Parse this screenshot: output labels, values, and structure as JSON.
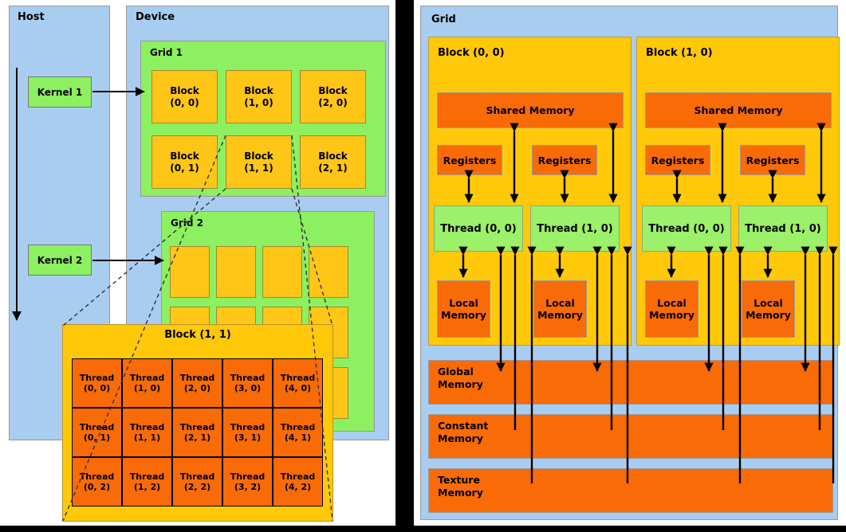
{
  "left_panel": {
    "host": {
      "title": "Host",
      "kernels": [
        {
          "label": "Kernel 1"
        },
        {
          "label": "Kernel 2"
        }
      ]
    },
    "device": {
      "title": "Device"
    },
    "grid1": {
      "title": "Grid 1",
      "blocks": [
        {
          "label": "Block\n(0, 0)"
        },
        {
          "label": "Block\n(1, 0)"
        },
        {
          "label": "Block\n(2, 0)"
        },
        {
          "label": "Block\n(0, 1)"
        },
        {
          "label": "Block\n(1, 1)"
        },
        {
          "label": "Block\n(2, 1)"
        }
      ]
    },
    "grid2": {
      "title": "Grid 2",
      "cols": 4,
      "rows": 3
    },
    "block_detail": {
      "title": "Block (1, 1)",
      "threads": [
        [
          "Thread\n(0, 0)",
          "Thread\n(1, 0)",
          "Thread\n(2, 0)",
          "Thread\n(3, 0)",
          "Thread\n(4, 0)"
        ],
        [
          "Thread\n(0, 1)",
          "Thread\n(1, 1)",
          "Thread\n(2, 1)",
          "Thread\n(3, 1)",
          "Thread\n(4, 1)"
        ],
        [
          "Thread\n(0, 2)",
          "Thread\n(1, 2)",
          "Thread\n(2, 2)",
          "Thread\n(3, 2)",
          "Thread\n(4, 2)"
        ]
      ]
    }
  },
  "right_panel": {
    "grid": {
      "title": "Grid"
    },
    "blocks": [
      {
        "title": "Block (0, 0)",
        "shared_memory": "Shared Memory",
        "lanes": [
          {
            "registers": "Registers",
            "thread": "Thread (0, 0)",
            "local_memory": "Local\nMemory"
          },
          {
            "registers": "Registers",
            "thread": "Thread (1, 0)",
            "local_memory": "Local\nMemory"
          }
        ]
      },
      {
        "title": "Block (1, 0)",
        "shared_memory": "Shared Memory",
        "lanes": [
          {
            "registers": "Registers",
            "thread": "Thread (0, 0)",
            "local_memory": "Local\nMemory"
          },
          {
            "registers": "Registers",
            "thread": "Thread (1, 0)",
            "local_memory": "Local\nMemory"
          }
        ]
      }
    ],
    "global_bars": [
      {
        "label": "Global\nMemory"
      },
      {
        "label": "Constant\nMemory"
      },
      {
        "label": "Texture\nMemory"
      }
    ]
  },
  "colors": {
    "host_blue": "#a8cdf0",
    "grid_green": "#8cf060",
    "block_gold": "#ffc90a",
    "memory_orange": "#f96b07",
    "thread_green": "#9cf06a",
    "outline": "#000000"
  }
}
